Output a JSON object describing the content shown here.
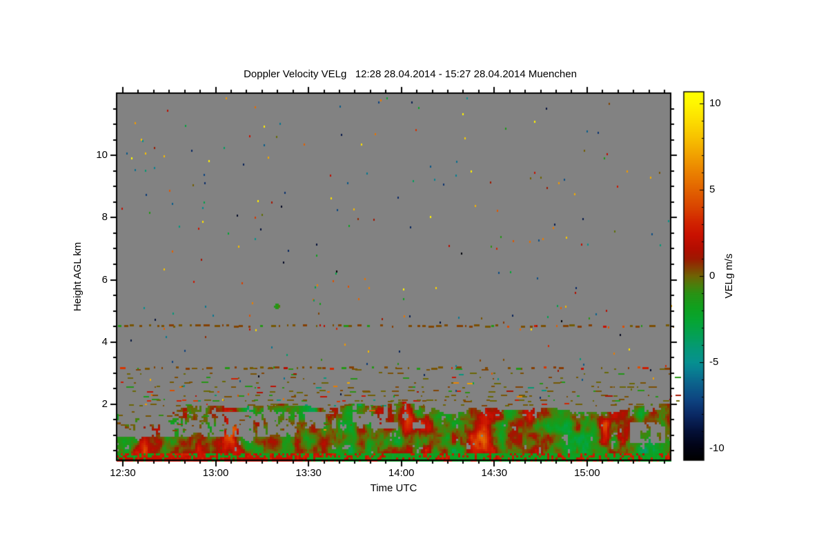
{
  "chart_data": {
    "type": "heatmap",
    "title": "Doppler Velocity VELg   12:28 28.04.2014 - 15:27 28.04.2014 Muenchen",
    "xlabel": "Time UTC",
    "ylabel": "Height AGL km",
    "colorbar_label": "VELg m/s",
    "no_data_color": "#828282",
    "x_axis": {
      "start_time": "12:28",
      "end_time": "15:27",
      "duration_min": 179,
      "major_ticks": [
        {
          "label": "12:30",
          "minute": 2
        },
        {
          "label": "13:00",
          "minute": 32
        },
        {
          "label": "13:30",
          "minute": 62
        },
        {
          "label": "14:00",
          "minute": 92
        },
        {
          "label": "14:30",
          "minute": 122
        },
        {
          "label": "15:00",
          "minute": 152
        }
      ],
      "minor_step_min": 5
    },
    "y_axis": {
      "min_km": 0.2,
      "max_km": 12.0,
      "major_ticks": [
        {
          "label": "10",
          "km": 10
        },
        {
          "label": "8",
          "km": 8
        },
        {
          "label": "6",
          "km": 6
        },
        {
          "label": "4",
          "km": 4
        },
        {
          "label": "2",
          "km": 2
        }
      ],
      "minor_step_km": 0.5
    },
    "colorbar": {
      "vmin": -10.7,
      "vmax": 10.7,
      "major_ticks": [
        {
          "label": "10",
          "v": 10
        },
        {
          "label": "5",
          "v": 5
        },
        {
          "label": "0",
          "v": 0
        },
        {
          "label": "-5",
          "v": -5
        },
        {
          "label": "-10",
          "v": -10
        }
      ],
      "minor_step": 1,
      "stops": [
        [
          -10.7,
          "#000000"
        ],
        [
          -9.8,
          "#010418"
        ],
        [
          -9.0,
          "#041038"
        ],
        [
          -8.0,
          "#0a2a66"
        ],
        [
          -7.2,
          "#0d4380"
        ],
        [
          -6.2,
          "#0c638c"
        ],
        [
          -5.4,
          "#088292"
        ],
        [
          -5.0,
          "#069090"
        ],
        [
          -4.2,
          "#059878"
        ],
        [
          -3.4,
          "#04a054"
        ],
        [
          -2.6,
          "#06a534"
        ],
        [
          -1.8,
          "#10a01e"
        ],
        [
          -1.0,
          "#2a9214"
        ],
        [
          -0.5,
          "#4b7e0c"
        ],
        [
          0.0,
          "#6e6404"
        ],
        [
          0.5,
          "#853f02"
        ],
        [
          1.0,
          "#9c1a01"
        ],
        [
          1.6,
          "#b30d00"
        ],
        [
          2.4,
          "#c91100"
        ],
        [
          3.2,
          "#d22600"
        ],
        [
          4.0,
          "#d94400"
        ],
        [
          5.0,
          "#e26200"
        ],
        [
          6.0,
          "#ea8000"
        ],
        [
          7.0,
          "#f1a000"
        ],
        [
          8.0,
          "#f7c000"
        ],
        [
          9.0,
          "#fcdc00"
        ],
        [
          10.0,
          "#fff600"
        ],
        [
          10.7,
          "#ffff00"
        ]
      ]
    },
    "features": {
      "seed": 1337,
      "speckles": {
        "count": 235,
        "km_min": 2.15,
        "km_max": 11.95,
        "v_min": -10.5,
        "v_max": 10.5
      },
      "blob": {
        "minute": 52,
        "km": 5.15,
        "v": -1.2
      },
      "streak_lines": [
        {
          "km": 4.55,
          "density": 0.55
        },
        {
          "km": 3.2,
          "density": 0.4
        }
      ],
      "scatter_band": {
        "km_min": 2.0,
        "km_max": 3.15,
        "rows": 9,
        "density": 0.26
      },
      "low_scatter": {
        "rows_km": [
          1.2,
          1.35,
          1.5,
          1.65,
          1.8
        ],
        "minute_max": 100,
        "density": 0.3
      },
      "boundary_layer": {
        "top_km_mean": 1.9,
        "top_km_noise": 0.45,
        "base_v": -4.2,
        "v_range": 7.2,
        "bottom_band_km": 0.4,
        "gap_base_threshold": 0.26,
        "red_columns": [
          [
            8,
            4,
            0.55,
            0.5,
            2.6
          ],
          [
            14,
            3,
            1.0,
            0.6,
            2.0
          ],
          [
            25,
            2.5,
            0.35,
            0.35,
            2.4
          ],
          [
            37,
            3.5,
            0.9,
            0.9,
            3.2
          ],
          [
            42,
            2,
            0.3,
            0.3,
            2.2
          ],
          [
            59,
            2.5,
            0.5,
            0.5,
            2.2
          ],
          [
            93,
            4,
            1.55,
            0.5,
            2.6
          ],
          [
            100,
            5,
            1.0,
            0.8,
            2.1
          ],
          [
            117,
            4,
            0.9,
            1.1,
            3.4
          ],
          [
            121,
            3,
            1.6,
            0.4,
            2.8
          ],
          [
            133,
            3,
            1.5,
            0.5,
            2.6
          ],
          [
            136,
            2.5,
            0.8,
            0.6,
            2.2
          ],
          [
            157,
            4,
            1.45,
            0.55,
            2.6
          ],
          [
            163,
            3,
            1.2,
            0.5,
            2.2
          ]
        ],
        "teal_patches": [
          [
            143,
            9,
            0.55,
            0.45,
            1.7
          ],
          [
            170,
            8,
            0.6,
            0.5,
            1.5
          ],
          [
            110,
            6,
            0.3,
            0.35,
            1.1
          ]
        ],
        "gap_regions": [
          [
            0,
            58,
            0.95,
            1.75,
            0.55
          ],
          [
            58,
            100,
            1.25,
            1.75,
            0.45
          ],
          [
            166,
            177,
            0.75,
            1.4,
            0.62
          ],
          [
            20,
            55,
            1.05,
            1.55,
            0.62
          ]
        ]
      }
    }
  }
}
